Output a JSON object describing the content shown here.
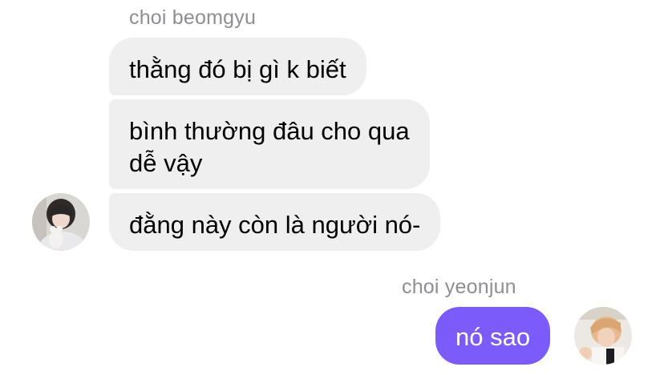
{
  "thread": {
    "incoming": {
      "sender": "choi beomgyu",
      "avatar_icon": "user-avatar-beomgyu",
      "messages": [
        "thằng đó bị gì k biết",
        "bình thường đâu cho qua\ndễ vậy",
        "đằng này còn là người nó-"
      ]
    },
    "outgoing": {
      "sender": "choi yeonjun",
      "avatar_icon": "user-avatar-yeonjun",
      "messages": [
        "nó sao"
      ]
    }
  },
  "colors": {
    "incoming_bubble": "#efefef",
    "outgoing_bubble": "#7b5cfa",
    "sender_name": "#8e8e93"
  }
}
